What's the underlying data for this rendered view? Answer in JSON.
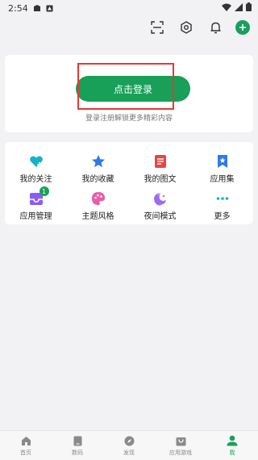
{
  "status_bar": {
    "time": "2:54"
  },
  "login": {
    "button_label": "点击登录",
    "hint": "登录注册解锁更多精彩内容"
  },
  "grid": {
    "items": [
      {
        "label": "我的关注",
        "icon": "heart-plus-icon",
        "color": "#16b3c6"
      },
      {
        "label": "我的收藏",
        "icon": "star-icon",
        "color": "#2d7be5"
      },
      {
        "label": "我的图文",
        "icon": "document-icon",
        "color": "#e54545"
      },
      {
        "label": "应用集",
        "icon": "bookmark-icon",
        "color": "#2d7be5"
      },
      {
        "label": "应用管理",
        "icon": "inbox-icon",
        "color": "#8a5cf6",
        "badge": "1"
      },
      {
        "label": "主题风格",
        "icon": "palette-icon",
        "color": "#ec5ba8"
      },
      {
        "label": "夜间模式",
        "icon": "moon-icon",
        "color": "#9b6cf0"
      },
      {
        "label": "更多",
        "icon": "more-icon",
        "color": "#16b3c6"
      }
    ]
  },
  "bottom_nav": {
    "items": [
      {
        "label": "首页",
        "icon": "home-icon"
      },
      {
        "label": "数码",
        "icon": "device-icon"
      },
      {
        "label": "发现",
        "icon": "compass-icon"
      },
      {
        "label": "应用游戏",
        "icon": "bag-icon"
      },
      {
        "label": "我",
        "icon": "user-icon",
        "active": true
      }
    ]
  },
  "colors": {
    "accent": "#18a058",
    "highlight": "#e53935"
  }
}
